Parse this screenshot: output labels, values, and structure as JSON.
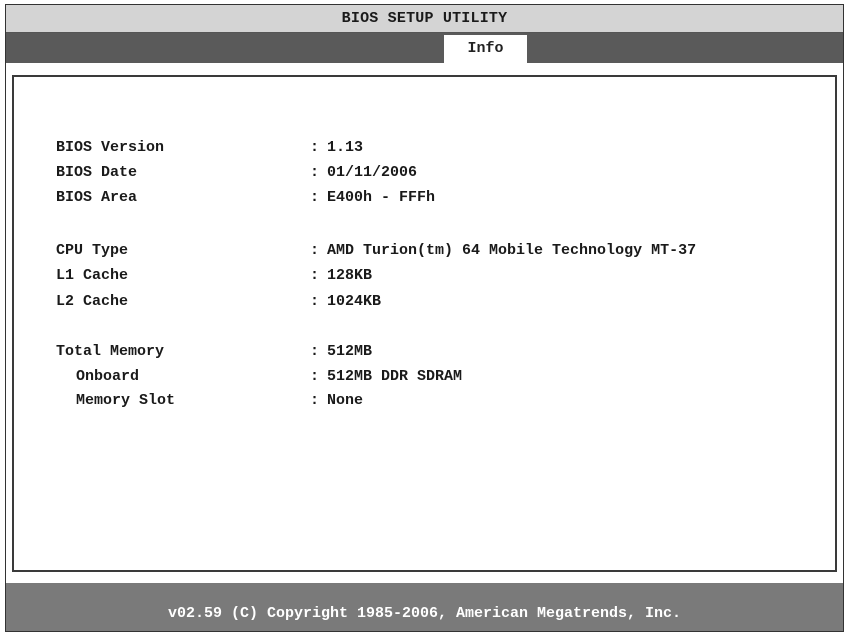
{
  "header": {
    "title": "BIOS SETUP UTILITY"
  },
  "tabs": [
    {
      "label": "Info",
      "selected": true
    }
  ],
  "info": {
    "bios_version": {
      "label": "BIOS Version",
      "value": "1.13"
    },
    "bios_date": {
      "label": "BIOS Date",
      "value": "01/11/2006"
    },
    "bios_area": {
      "label": "BIOS Area",
      "value": "E400h - FFFh"
    },
    "cpu_type": {
      "label": "CPU Type",
      "value": "AMD Turion(tm) 64 Mobile Technology MT-37"
    },
    "l1_cache": {
      "label": "L1 Cache",
      "value": "128KB"
    },
    "l2_cache": {
      "label": "L2 Cache",
      "value": "1024KB"
    },
    "total_memory": {
      "label": "Total Memory",
      "value": "512MB"
    },
    "onboard": {
      "label": "Onboard",
      "value": "512MB DDR SDRAM"
    },
    "memory_slot": {
      "label": "Memory Slot",
      "value": "None"
    },
    "separator": ":"
  },
  "footer": {
    "copyright": "v02.59 (C) Copyright 1985-2006, American Megatrends, Inc."
  },
  "colors": {
    "title_bar": "#d4d4d4",
    "tab_bar": "#5a5a5a",
    "tab_selected": "#ffffff",
    "footer_bar": "#7a7a7a",
    "text": "#1a1a1a",
    "footer_text": "#ffffff"
  }
}
